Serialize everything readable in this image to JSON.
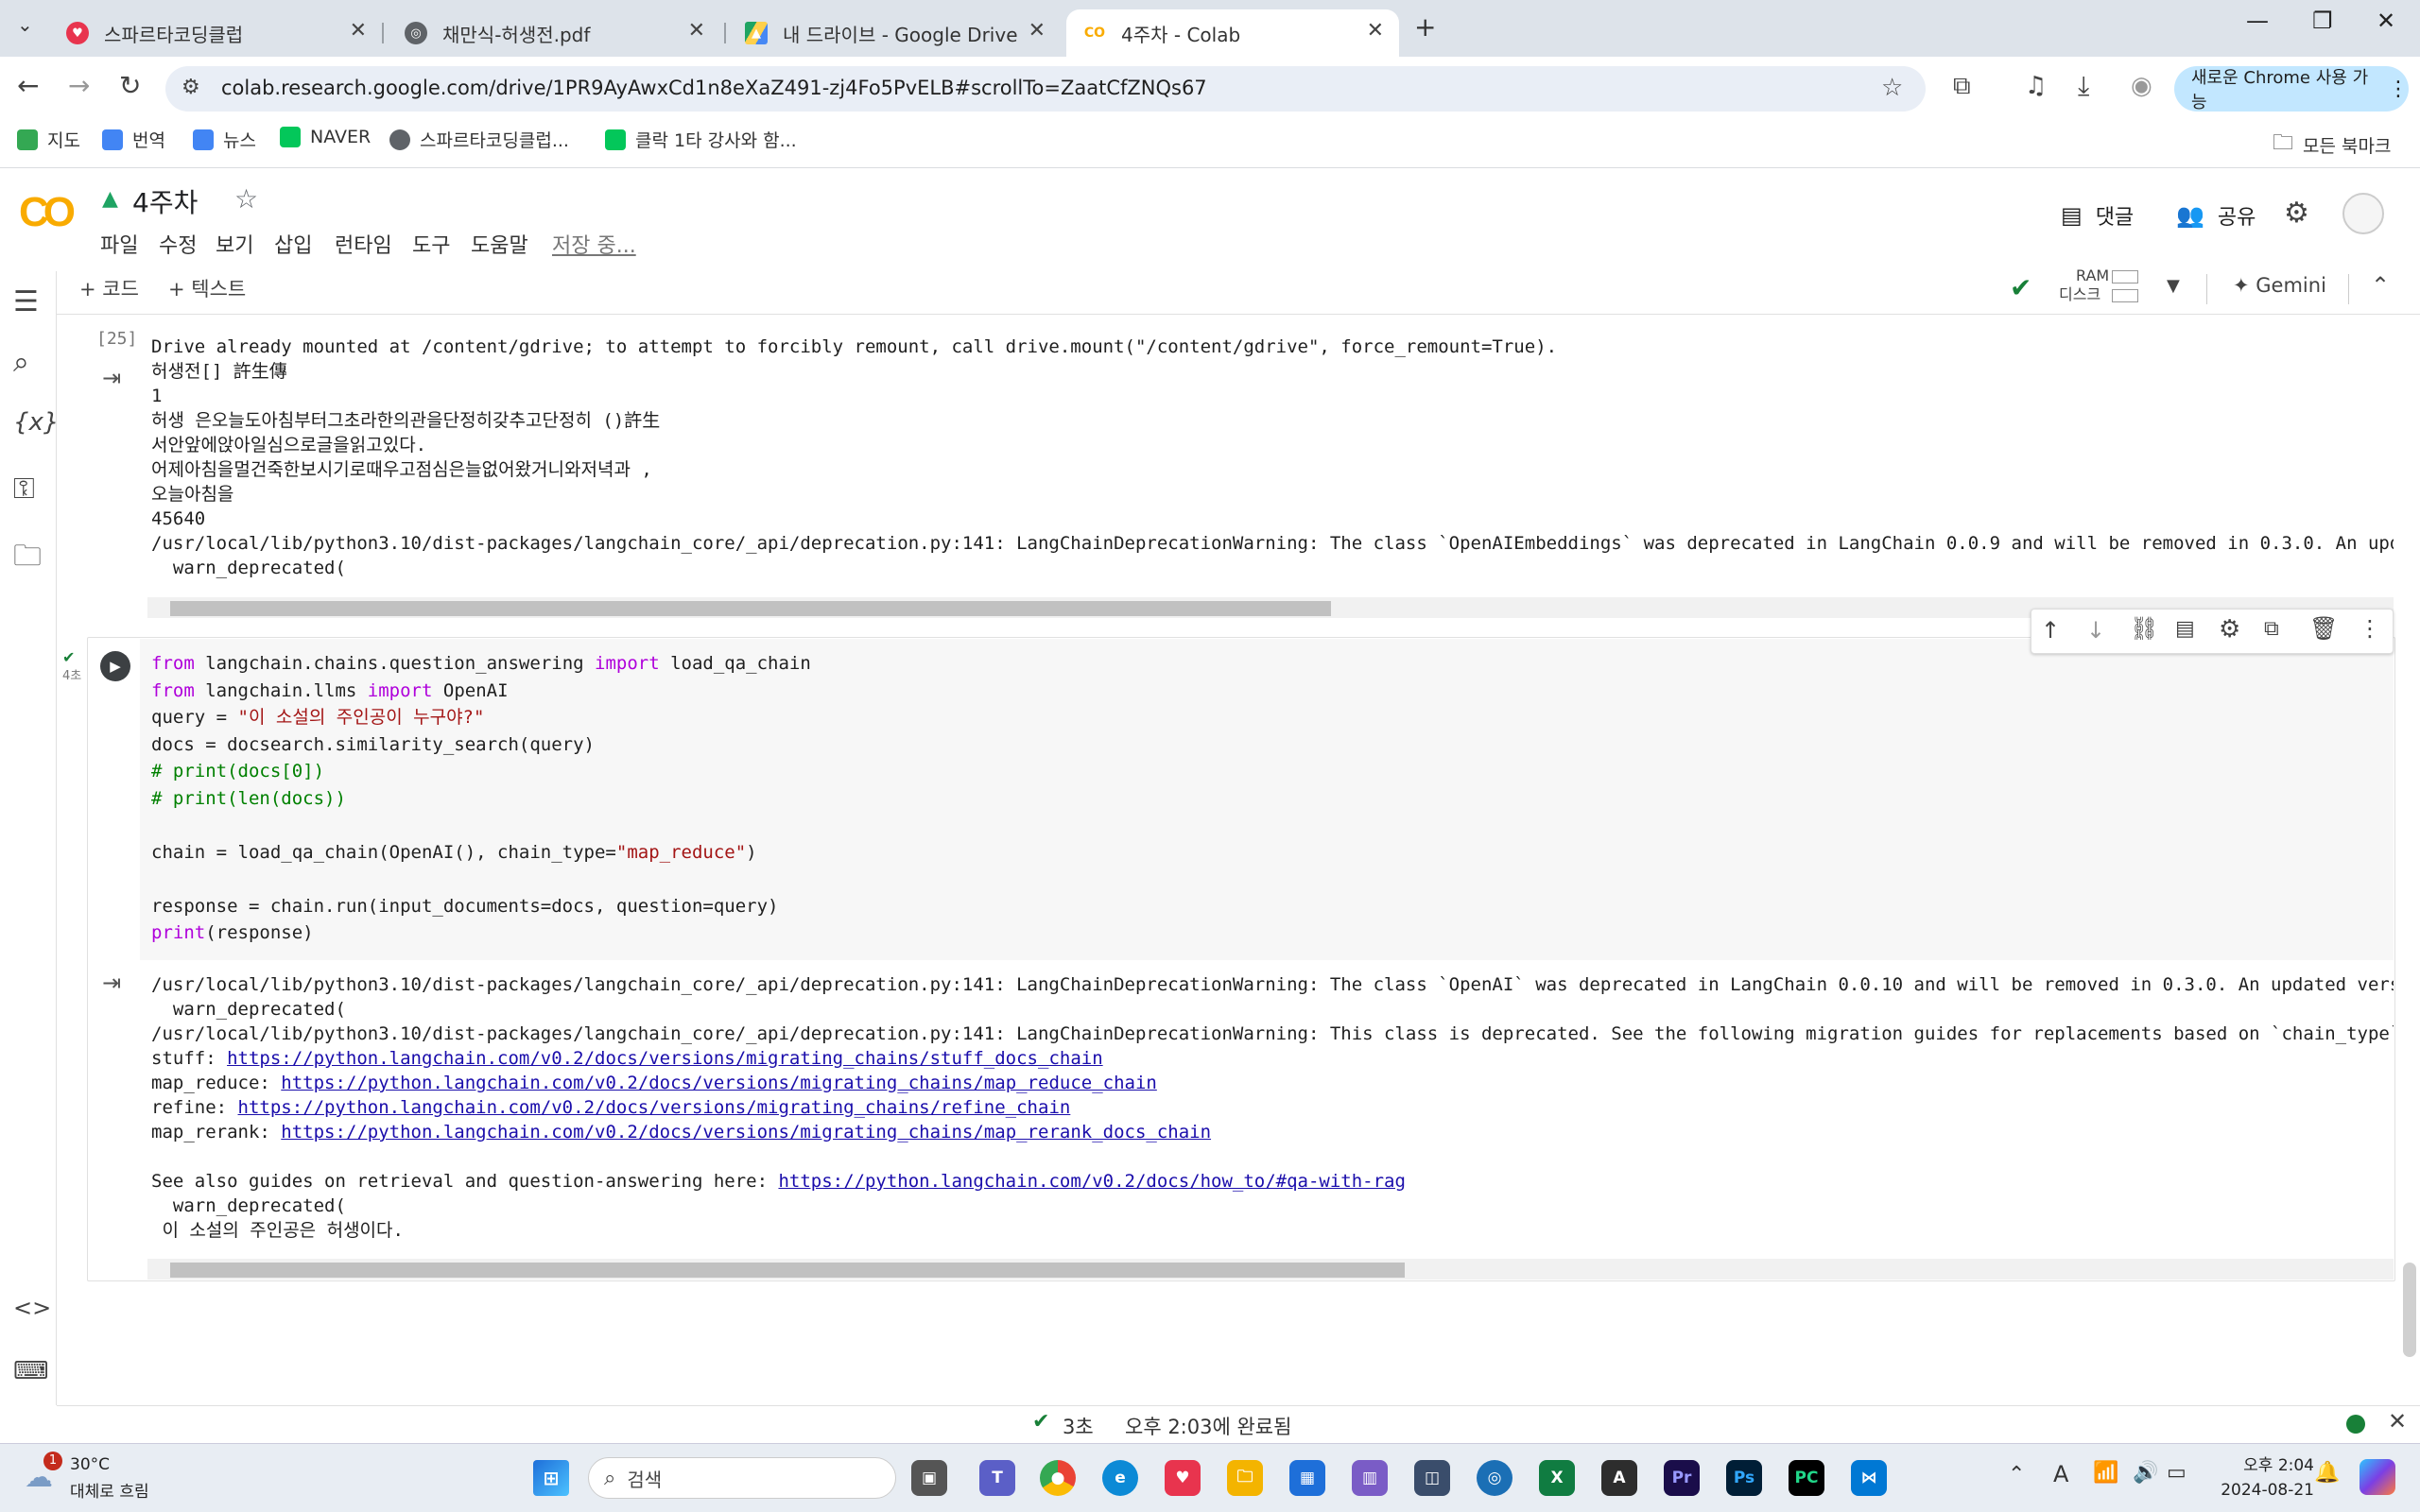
{
  "tabs": [
    {
      "title": "스파르타코딩클럽",
      "icon_color": "#e8344e",
      "active": false
    },
    {
      "title": "채만식-허생전.pdf",
      "icon_color": "#5f6368",
      "active": false
    },
    {
      "title": "내 드라이브 - Google Drive",
      "icon_color": "#1fa463",
      "active": false
    },
    {
      "title": "4주차 - Colab",
      "icon_color": "#f9ab00",
      "active": true
    }
  ],
  "address": {
    "url": "colab.research.google.com/drive/1PR9AyAwxCd1n8eXaZ491-zj4Fo5PvELB#scrollTo=ZaatCfZNQs67",
    "chrome_update_label": "새로운 Chrome 사용 가능"
  },
  "bookmarks": [
    {
      "label": "지도",
      "color": "#34a853"
    },
    {
      "label": "번역",
      "color": "#4285f4"
    },
    {
      "label": "뉴스",
      "color": "#4285f4"
    },
    {
      "label": "NAVER",
      "color": "#03c75a"
    },
    {
      "label": "스파르타코딩클럽...",
      "color": "#5f6368"
    },
    {
      "label": "클락 1타 강사와 함...",
      "color": "#03c75a"
    }
  ],
  "all_bookmarks_label": "모든 북마크",
  "notebook": {
    "logo": "CO",
    "title": "4주차",
    "menu": [
      "파일",
      "수정",
      "보기",
      "삽입",
      "런타임",
      "도구",
      "도움말"
    ],
    "saving": "저장 중...",
    "comment_label": "댓글",
    "share_label": "공유"
  },
  "toolbar": {
    "add_code": "+ 코드",
    "add_text": "+ 텍스트",
    "ram_label": "RAM",
    "disk_label": "디스크",
    "gemini_label": "Gemini"
  },
  "cell1": {
    "exec_count": "[25]",
    "output_lines": [
      "Drive already mounted at /content/gdrive; to attempt to forcibly remount, call drive.mount(\"/content/gdrive\", force_remount=True).",
      "허생전[] 許生傳",
      "1",
      "허생 은오늘도아침부터그초라한의관을단정히갖추고단정히 ()許生",
      "서안앞에앉아일심으로글을읽고있다.",
      "어제아침을멀건죽한보시기로때우고점심은늘없어왔거니와저녁과 ,",
      "오늘아침을",
      "45640",
      "/usr/local/lib/python3.10/dist-packages/langchain_core/_api/deprecation.py:141: LangChainDeprecationWarning: The class `OpenAIEmbeddings` was deprecated in LangChain 0.0.9 and will be removed in 0.3.0. An updated ver",
      "  warn_deprecated("
    ]
  },
  "cell2": {
    "time_label": "4초",
    "code": [
      [
        {
          "t": "from",
          "c": "kw"
        },
        {
          "t": " langchain.chains.question_answering ",
          "c": ""
        },
        {
          "t": "import",
          "c": "kw"
        },
        {
          "t": " load_qa_chain",
          "c": ""
        }
      ],
      [
        {
          "t": "from",
          "c": "kw"
        },
        {
          "t": " langchain.llms ",
          "c": ""
        },
        {
          "t": "import",
          "c": "kw"
        },
        {
          "t": " OpenAI",
          "c": ""
        }
      ],
      [
        {
          "t": "query = ",
          "c": ""
        },
        {
          "t": "\"이 소설의 주인공이 누구야?\"",
          "c": "str"
        }
      ],
      [
        {
          "t": "docs = docsearch.similarity_search(query)",
          "c": ""
        }
      ],
      [
        {
          "t": "# print(docs[0])",
          "c": "cmt"
        }
      ],
      [
        {
          "t": "# print(len(docs))",
          "c": "cmt"
        }
      ],
      [],
      [
        {
          "t": "chain = load_qa_chain(OpenAI(), chain_type=",
          "c": ""
        },
        {
          "t": "\"map_reduce\"",
          "c": "str"
        },
        {
          "t": ")",
          "c": ""
        }
      ],
      [],
      [
        {
          "t": "response = chain.run(input_documents=docs, question=query)",
          "c": ""
        }
      ],
      [
        {
          "t": "print",
          "c": "kw"
        },
        {
          "t": "(response)",
          "c": ""
        }
      ]
    ],
    "output": [
      [
        {
          "t": "/usr/local/lib/python3.10/dist-packages/langchain_core/_api/deprecation.py:141: LangChainDeprecationWarning: The class `OpenAI` was deprecated in LangChain 0.0.10 and will be removed in 0.3.0. An updated version of t",
          "c": ""
        }
      ],
      [
        {
          "t": "  warn_deprecated(",
          "c": ""
        }
      ],
      [
        {
          "t": "/usr/local/lib/python3.10/dist-packages/langchain_core/_api/deprecation.py:141: LangChainDeprecationWarning: This class is deprecated. See the following migration guides for replacements based on `chain_type`:",
          "c": ""
        }
      ],
      [
        {
          "t": "stuff: ",
          "c": ""
        },
        {
          "t": "https://python.langchain.com/v0.2/docs/versions/migrating_chains/stuff_docs_chain",
          "c": "lnk"
        }
      ],
      [
        {
          "t": "map_reduce: ",
          "c": ""
        },
        {
          "t": "https://python.langchain.com/v0.2/docs/versions/migrating_chains/map_reduce_chain",
          "c": "lnk"
        }
      ],
      [
        {
          "t": "refine: ",
          "c": ""
        },
        {
          "t": "https://python.langchain.com/v0.2/docs/versions/migrating_chains/refine_chain",
          "c": "lnk"
        }
      ],
      [
        {
          "t": "map_rerank: ",
          "c": ""
        },
        {
          "t": "https://python.langchain.com/v0.2/docs/versions/migrating_chains/map_rerank_docs_chain",
          "c": "lnk"
        }
      ],
      [],
      [
        {
          "t": "See also guides on retrieval and question-answering here: ",
          "c": ""
        },
        {
          "t": "https://python.langchain.com/v0.2/docs/how_to/#qa-with-rag",
          "c": "lnk"
        }
      ],
      [
        {
          "t": "  warn_deprecated(",
          "c": ""
        }
      ],
      [
        {
          "t": " 이 소설의 주인공은 허생이다.",
          "c": ""
        }
      ]
    ]
  },
  "status": {
    "duration": "3초",
    "completed": "오후 2:03에 완료됨"
  },
  "taskbar": {
    "weather_temp": "30°C",
    "weather_desc": "대체로 흐림",
    "weather_badge": "1",
    "search_label": "검색",
    "clock_time": "오후 2:04",
    "clock_date": "2024-08-21"
  }
}
